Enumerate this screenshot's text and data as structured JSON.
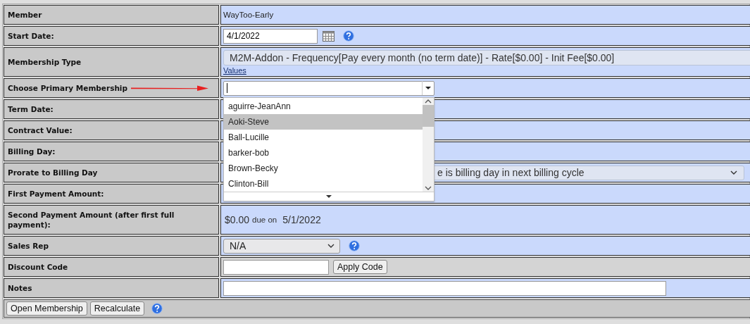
{
  "fields": [
    {
      "label": "Member",
      "kind": "text",
      "value": "WayToo-Early"
    },
    {
      "label": "Start Date:",
      "kind": "date",
      "value": "4/1/2022"
    },
    {
      "label": "Membership Type",
      "kind": "membership",
      "value": "M2M-Addon - Frequency[Pay every month (no term date)] - Rate[$0.00] - Init Fee[$0.00]",
      "link": "Values"
    },
    {
      "label": "Choose Primary Membership",
      "kind": "combo"
    },
    {
      "label": "Term Date:",
      "kind": "empty"
    },
    {
      "label": "Contract Value:",
      "kind": "empty"
    },
    {
      "label": "Billing Day:",
      "kind": "empty"
    },
    {
      "label": "Prorate to Billing Day",
      "kind": "wide_select",
      "value": "e is billing day in next billing cycle"
    },
    {
      "label": "First Payment Amount:",
      "kind": "empty"
    },
    {
      "label": "Second Payment Amount (after first full payment):",
      "kind": "payment",
      "amount": "$0.00",
      "due": "due on",
      "date": "5/1/2022"
    },
    {
      "label": "Sales Rep",
      "kind": "select",
      "value": "N/A"
    },
    {
      "label": "Discount Code",
      "kind": "discount",
      "button": "Apply Code"
    },
    {
      "label": "Notes",
      "kind": "notes"
    }
  ],
  "dropdown": {
    "items": [
      {
        "label": "aguirre-JeanAnn",
        "selected": false
      },
      {
        "label": "Aoki-Steve",
        "selected": true
      },
      {
        "label": "Ball-Lucille",
        "selected": false
      },
      {
        "label": "barker-bob",
        "selected": false
      },
      {
        "label": "Brown-Becky",
        "selected": false
      },
      {
        "label": "Clinton-Bill",
        "selected": false
      }
    ]
  },
  "buttons": [
    "Open Membership",
    "Recalculate"
  ]
}
